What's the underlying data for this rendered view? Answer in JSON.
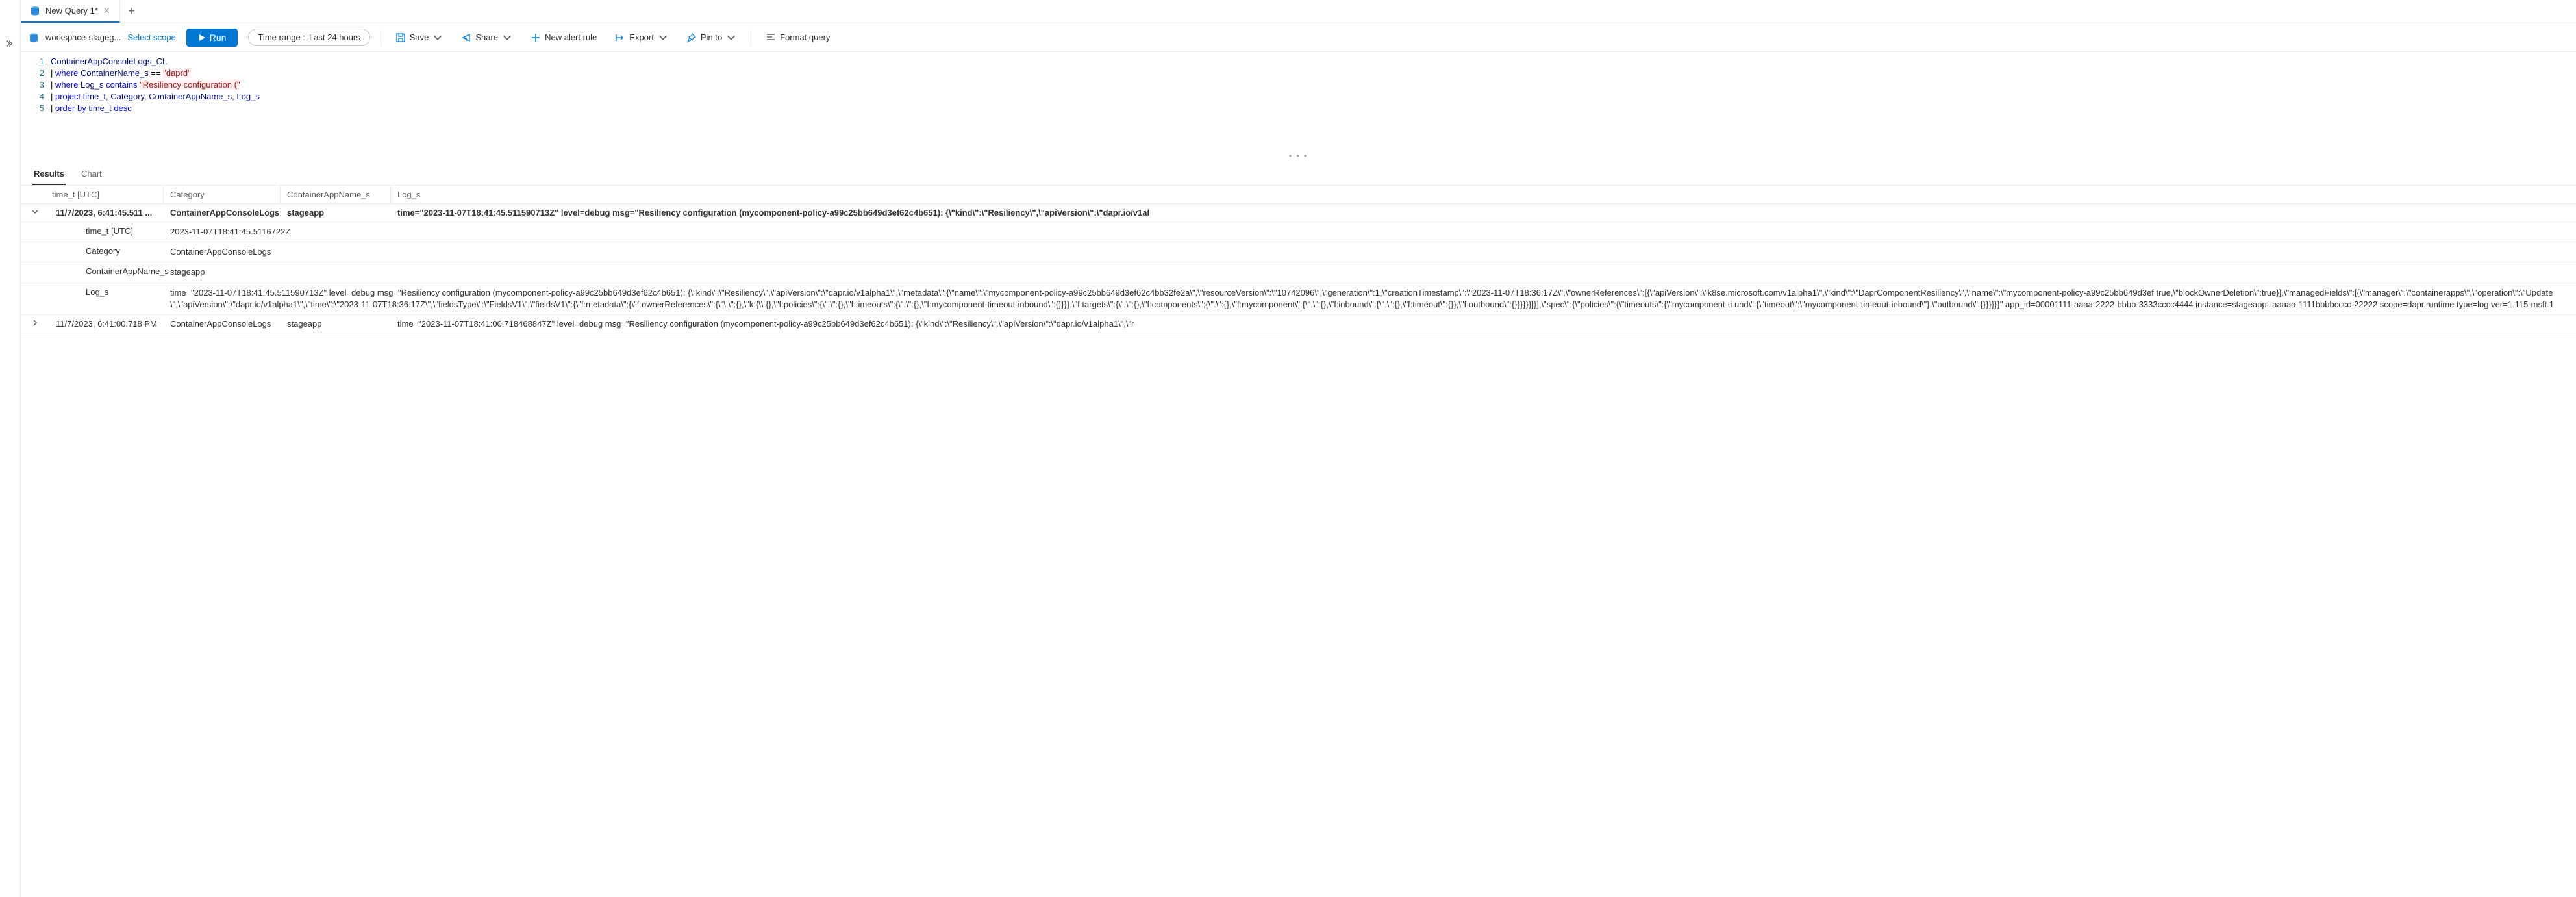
{
  "tab": {
    "title": "New Query 1*"
  },
  "toolbar": {
    "workspace": "workspace-stageg...",
    "select_scope": "Select scope",
    "run": "Run",
    "time_range_label": "Time range :",
    "time_range_value": "Last 24 hours",
    "save": "Save",
    "share": "Share",
    "new_alert": "New alert rule",
    "export": "Export",
    "pin_to": "Pin to",
    "format": "Format query"
  },
  "editor": {
    "lines": [
      {
        "n": "1",
        "tokens": [
          {
            "t": "ContainerAppConsoleLogs_CL",
            "c": "col"
          }
        ]
      },
      {
        "n": "2",
        "tokens": [
          {
            "t": "| ",
            "c": "pipe"
          },
          {
            "t": "where",
            "c": "kw"
          },
          {
            "t": " ContainerName_s ",
            "c": "col"
          },
          {
            "t": "==",
            "c": "op"
          },
          {
            "t": " ",
            "c": ""
          },
          {
            "t": "\"daprd\"",
            "c": "str"
          }
        ]
      },
      {
        "n": "3",
        "tokens": [
          {
            "t": "| ",
            "c": "pipe"
          },
          {
            "t": "where",
            "c": "kw"
          },
          {
            "t": " Log_s ",
            "c": "col"
          },
          {
            "t": "contains",
            "c": "kw"
          },
          {
            "t": " ",
            "c": ""
          },
          {
            "t": "\"Resiliency configuration (\"",
            "c": "str"
          }
        ]
      },
      {
        "n": "4",
        "tokens": [
          {
            "t": "| ",
            "c": "pipe"
          },
          {
            "t": "project",
            "c": "kw"
          },
          {
            "t": " time_t, Category, ContainerAppName_s, Log_s",
            "c": "col"
          }
        ]
      },
      {
        "n": "5",
        "tokens": [
          {
            "t": "| ",
            "c": "pipe"
          },
          {
            "t": "order by",
            "c": "kw"
          },
          {
            "t": " time_t ",
            "c": "col"
          },
          {
            "t": "desc",
            "c": "kw"
          }
        ]
      }
    ]
  },
  "results_tabs": {
    "results": "Results",
    "chart": "Chart"
  },
  "columns": {
    "c1": "time_t [UTC]",
    "c2": "Category",
    "c3": "ContainerAppName_s",
    "c4": "Log_s"
  },
  "rows": [
    {
      "expanded": true,
      "time": "11/7/2023, 6:41:45.511 ...",
      "category": "ContainerAppConsoleLogs",
      "app": "stageapp",
      "log": "time=\"2023-11-07T18:41:45.511590713Z\" level=debug msg=\"Resiliency configuration (mycomponent-policy-a99c25bb649d3ef62c4b651): {\\\"kind\\\":\\\"Resiliency\\\",\\\"apiVersion\\\":\\\"dapr.io/v1al",
      "details": [
        {
          "k": "time_t [UTC]",
          "v": "2023-11-07T18:41:45.5116722Z"
        },
        {
          "k": "Category",
          "v": "ContainerAppConsoleLogs"
        },
        {
          "k": "ContainerAppName_s",
          "v": "stageapp"
        },
        {
          "k": "Log_s",
          "v": "time=\"2023-11-07T18:41:45.511590713Z\" level=debug msg=\"Resiliency configuration (mycomponent-policy-a99c25bb649d3ef62c4b651): {\\\"kind\\\":\\\"Resiliency\\\",\\\"apiVersion\\\":\\\"dapr.io/v1alpha1\\\",\\\"metadata\\\":{\\\"name\\\":\\\"mycomponent-policy-a99c25bb649d3ef62c4bb32fe2a\\\",\\\"resourceVersion\\\":\\\"10742096\\\",\\\"generation\\\":1,\\\"creationTimestamp\\\":\\\"2023-11-07T18:36:17Z\\\",\\\"ownerReferences\\\":[{\\\"apiVersion\\\":\\\"k8se.microsoft.com/v1alpha1\\\",\\\"kind\\\":\\\"DaprComponentResiliency\\\",\\\"name\\\":\\\"mycomponent-policy-a99c25bb649d3ef true,\\\"blockOwnerDeletion\\\":true}],\\\"managedFields\\\":[{\\\"manager\\\":\\\"containerapps\\\",\\\"operation\\\":\\\"Update\\\",\\\"apiVersion\\\":\\\"dapr.io/v1alpha1\\\",\\\"time\\\":\\\"2023-11-07T18:36:17Z\\\",\\\"fieldsType\\\":\\\"FieldsV1\\\",\\\"fieldsV1\\\":{\\\"f:metadata\\\":{\\\"f:ownerReferences\\\":{\\\"\\.\\\":{},\\\"k:{\\\\ {},\\\"f:policies\\\":{\\\".\\\":{},\\\"f:timeouts\\\":{\\\".\\\":{},\\\"f:mycomponent-timeout-inbound\\\":{}}}},\\\"f:targets\\\":{\\\".\\\":{},\\\"f:components\\\":{\\\".\\\":{},\\\"f:mycomponent\\\":{\\\".\\\":{},\\\"f:inbound\\\":{\\\".\\\":{},\\\"f:timeout\\\":{}},\\\"f:outbound\\\":{}}}}}}]}],\\\"spec\\\":{\\\"policies\\\":{\\\"timeouts\\\":{\\\"mycomponent-ti und\\\":{\\\"timeout\\\":\\\"mycomponent-timeout-inbound\\\"},\\\"outbound\\\":{}}}}}}\" app_id=00001111-aaaa-2222-bbbb-3333cccc4444 instance=stageapp--aaaaa-1111bbbbcccc-22222 scope=dapr.runtime type=log ver=1.115-msft.1"
        }
      ]
    },
    {
      "expanded": false,
      "time": "11/7/2023, 6:41:00.718 PM",
      "category": "ContainerAppConsoleLogs",
      "app": "stageapp",
      "log": "time=\"2023-11-07T18:41:00.718468847Z\" level=debug msg=\"Resiliency configuration (mycomponent-policy-a99c25bb649d3ef62c4b651): {\\\"kind\\\":\\\"Resiliency\\\",\\\"apiVersion\\\":\\\"dapr.io/v1alpha1\\\",\\\"r"
    }
  ],
  "drag_dots": "• • •"
}
